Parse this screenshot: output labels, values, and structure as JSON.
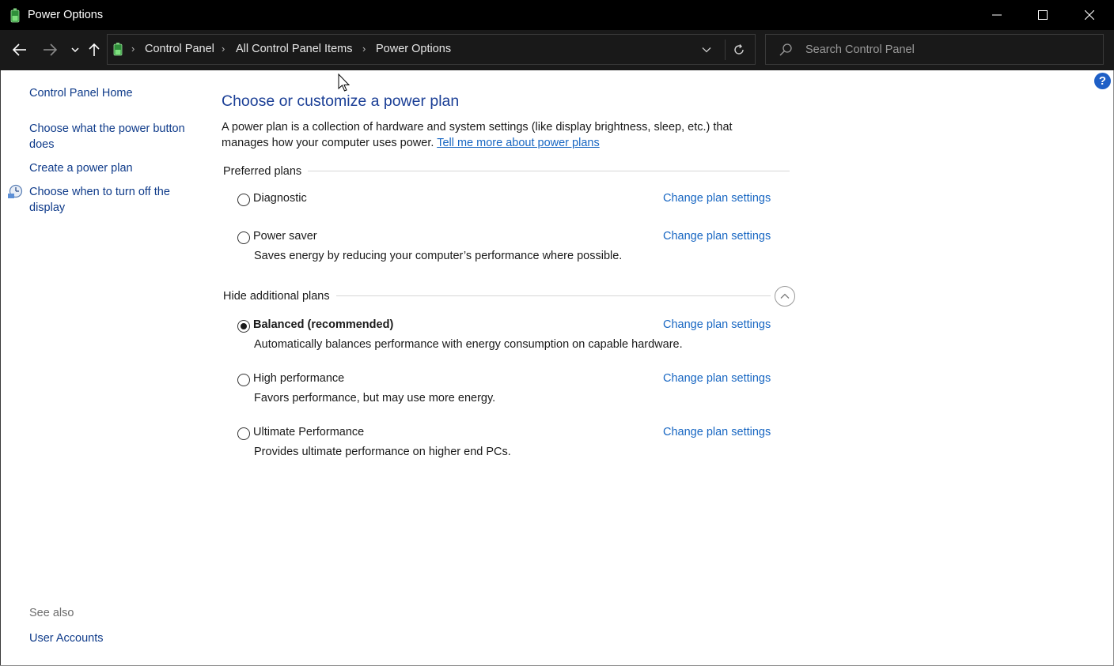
{
  "window": {
    "title": "Power Options",
    "minimize_glyph": "—",
    "maximize_glyph": "☐",
    "close_glyph": "✕"
  },
  "navigation": {
    "breadcrumbs": [
      "Control Panel",
      "All Control Panel Items",
      "Power Options"
    ],
    "separator": "›"
  },
  "search": {
    "placeholder": "Search Control Panel",
    "value": ""
  },
  "help": {
    "label": "?"
  },
  "sidebar": {
    "home": "Control Panel Home",
    "links": [
      "Choose what the power button does",
      "Create a power plan",
      "Choose when to turn off the display"
    ],
    "see_also_label": "See also",
    "see_also_links": [
      "User Accounts"
    ]
  },
  "main": {
    "title": "Choose or customize a power plan",
    "description": "A power plan is a collection of hardware and system settings (like display brightness, sleep, etc.) that manages how your computer uses power.",
    "learn_more": "Tell me more about power plans",
    "preferred_label": "Preferred plans",
    "additional_label": "Hide additional plans",
    "change_label": "Change plan settings",
    "plans": [
      {
        "name": "Diagnostic",
        "description": "",
        "selected": false
      },
      {
        "name": "Power saver",
        "description": "Saves energy by reducing your computer’s performance where possible.",
        "selected": false
      },
      {
        "name": "Balanced (recommended)",
        "description": "Automatically balances performance with energy consumption on capable hardware.",
        "selected": true
      },
      {
        "name": "High performance",
        "description": "Favors performance, but may use more energy.",
        "selected": false
      },
      {
        "name": "Ultimate Performance",
        "description": "Provides ultimate performance on higher end PCs.",
        "selected": false
      }
    ]
  },
  "colors": {
    "titlebar": "#000000",
    "addressbar": "#191919",
    "link": "#1766c2",
    "heading": "#1b3f96"
  }
}
